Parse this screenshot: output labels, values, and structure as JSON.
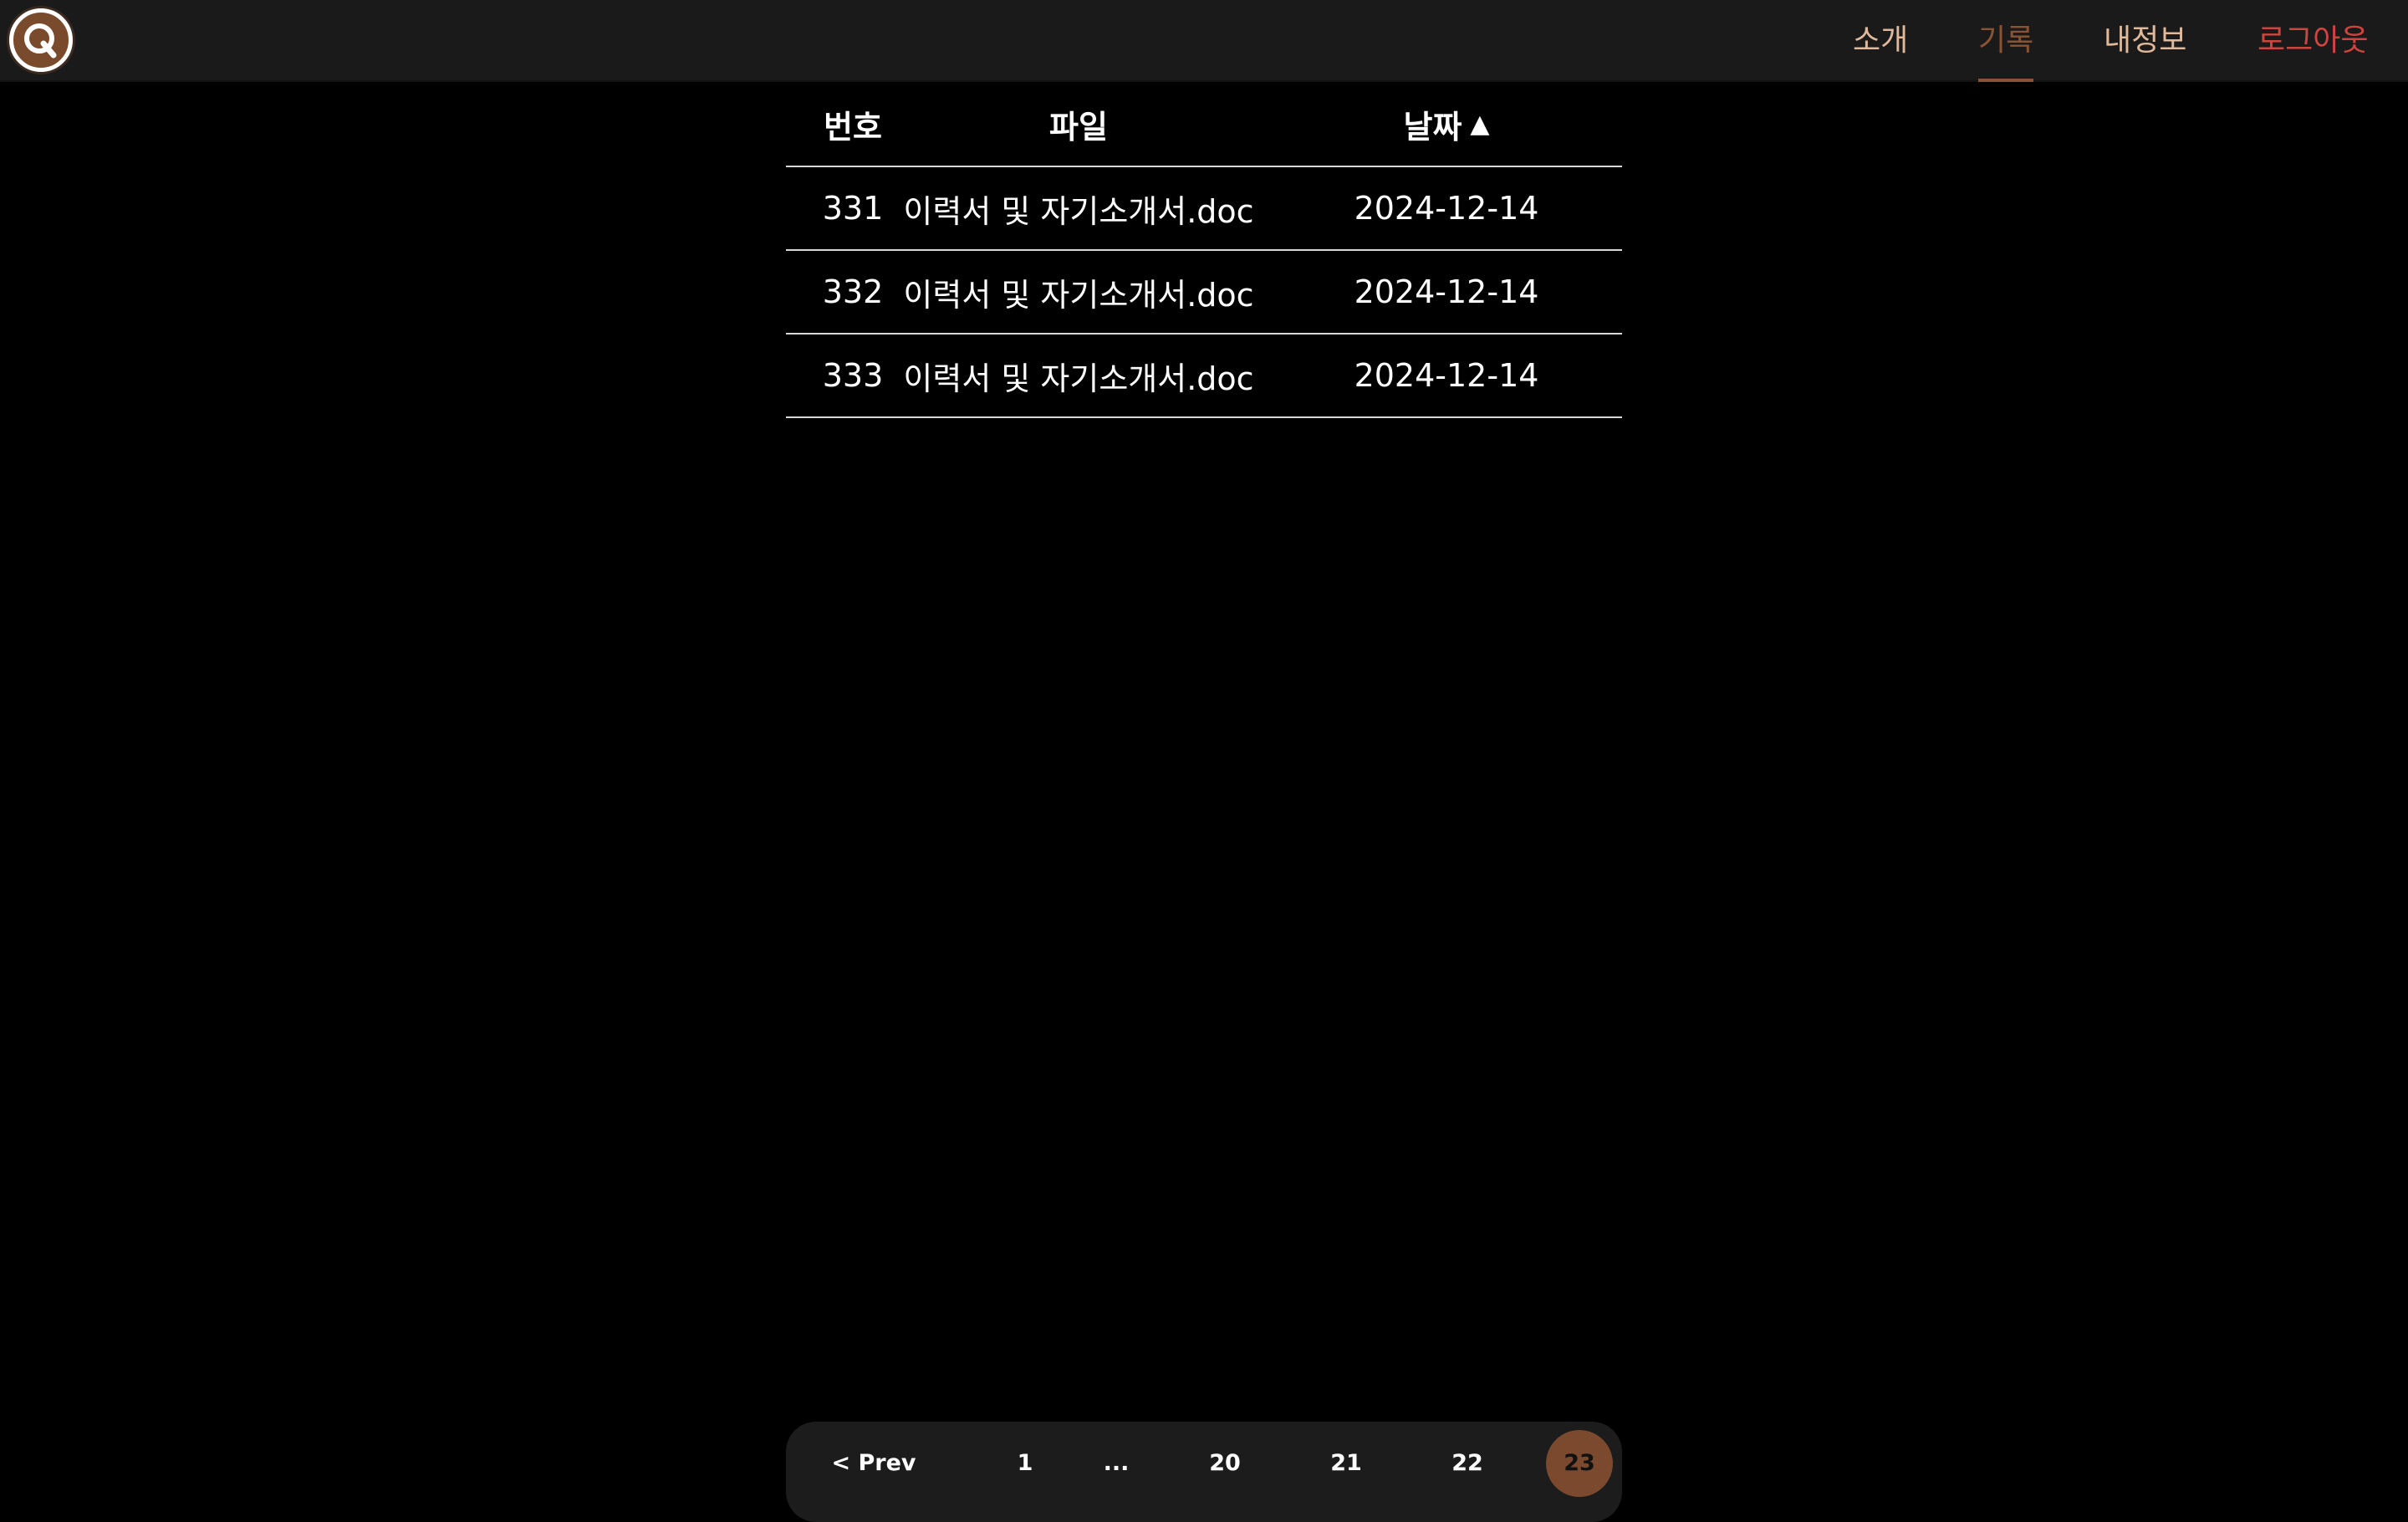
{
  "header": {
    "logo_letter": "Q",
    "nav": {
      "intro": "소개",
      "records": "기록",
      "my_info": "내정보",
      "logout": "로그아웃"
    }
  },
  "table": {
    "columns": {
      "number": "번호",
      "file": "파일",
      "date": "날짜",
      "sort_indicator": "▲"
    },
    "rows": [
      {
        "number": "331",
        "file": "이력서 및 자기소개서.doc",
        "date": "2024-12-14"
      },
      {
        "number": "332",
        "file": "이력서 및 자기소개서.doc",
        "date": "2024-12-14"
      },
      {
        "number": "333",
        "file": "이력서 및 자기소개서.doc",
        "date": "2024-12-14"
      }
    ]
  },
  "pagination": {
    "prev": "< Prev",
    "first": "1",
    "ellipsis": "...",
    "pages": [
      "20",
      "21",
      "22",
      "23"
    ],
    "current": "23"
  },
  "colors": {
    "background": "#000000",
    "header_bg": "#1a1a1a",
    "nav_text": "#e0b89a",
    "nav_active": "#8a5434",
    "logout": "#d0443f",
    "current_page_bg": "#7b4a2e"
  }
}
